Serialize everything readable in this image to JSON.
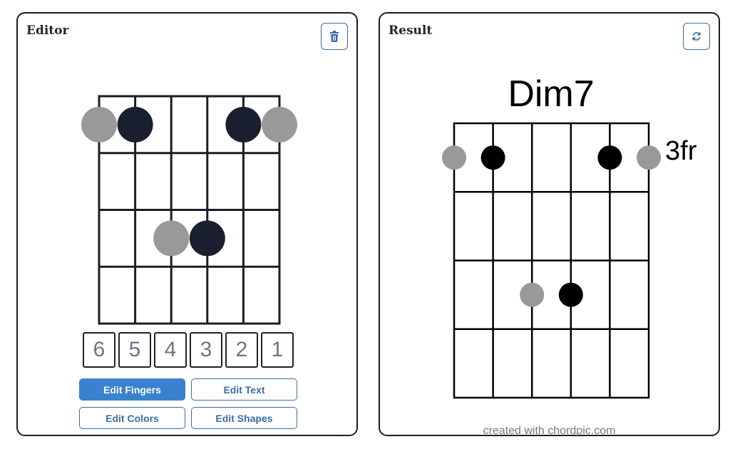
{
  "editor": {
    "title": "Editor",
    "delete_icon": "trash-icon",
    "strings": [
      "6",
      "5",
      "4",
      "3",
      "2",
      "1"
    ],
    "buttons": {
      "edit_fingers": "Edit Fingers",
      "edit_text": "Edit Text",
      "edit_colors": "Edit Colors",
      "edit_shapes": "Edit Shapes"
    },
    "active_button": "edit_fingers"
  },
  "result": {
    "title": "Result",
    "refresh_icon": "refresh-icon",
    "chord_name": "Dim7",
    "fret_label": "3fr",
    "credit": "created with chordpic.com"
  },
  "chord": {
    "frets": 4,
    "strings": 6,
    "dots": [
      {
        "string": 6,
        "fret": 1,
        "color": "#999999"
      },
      {
        "string": 5,
        "fret": 1,
        "color": "#1b2030"
      },
      {
        "string": 2,
        "fret": 1,
        "color": "#1b2030"
      },
      {
        "string": 1,
        "fret": 1,
        "color": "#999999"
      },
      {
        "string": 4,
        "fret": 3,
        "color": "#999999"
      },
      {
        "string": 3,
        "fret": 3,
        "color": "#1b2030"
      }
    ]
  },
  "colors": {
    "accent": "#3a82cf",
    "border": "#3a6ea5"
  }
}
